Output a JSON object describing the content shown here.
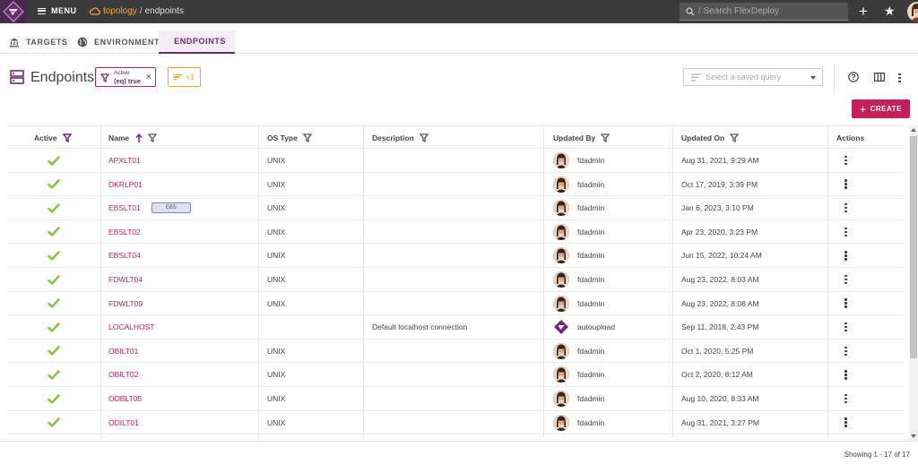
{
  "topbar": {
    "menu_label": "MENU",
    "breadcrumb": {
      "root": "topology",
      "separator": "/",
      "current": "endpoints"
    },
    "search_placeholder": "/ Search FlexDeploy"
  },
  "tabs": [
    {
      "label": "TARGETS",
      "icon": "bank-icon",
      "active": false
    },
    {
      "label": "ENVIRONMENTS",
      "icon": "globe-icon",
      "active": false
    },
    {
      "label": "ENDPOINTS",
      "icon": "server-icon",
      "active": true
    }
  ],
  "page": {
    "title": "Endpoints",
    "filter_chip": {
      "label": "Active",
      "value": "(eq) true"
    },
    "sort_chip": {
      "label": "+1"
    },
    "saved_query_placeholder": "Select a saved query",
    "create_label": "CREATE"
  },
  "columns": [
    "Active",
    "Name",
    "OS Type",
    "Description",
    "Updated By",
    "Updated On",
    "Actions"
  ],
  "rows": [
    {
      "name": "APXLT01",
      "os": "UNIX",
      "description": "",
      "updated_by": "fdadmin",
      "updated_on": "Aug 31, 2021, 9:29 AM"
    },
    {
      "name": "DKRLP01",
      "os": "UNIX",
      "description": "",
      "updated_by": "fdadmin",
      "updated_on": "Oct 17, 2019, 3:39 PM"
    },
    {
      "name": "EBSLT01",
      "tag": "EBS",
      "os": "UNIX",
      "description": "",
      "updated_by": "fdadmin",
      "updated_on": "Jan 6, 2023, 3:10 PM"
    },
    {
      "name": "EBSLT02",
      "os": "UNIX",
      "description": "",
      "updated_by": "fdadmin",
      "updated_on": "Apr 23, 2020, 3:23 PM"
    },
    {
      "name": "EBSLT04",
      "os": "UNIX",
      "description": "",
      "updated_by": "fdadmin",
      "updated_on": "Jun 15, 2022, 10:24 AM"
    },
    {
      "name": "FDWLT04",
      "os": "UNIX",
      "description": "",
      "updated_by": "fdadmin",
      "updated_on": "Aug 23, 2022, 8:03 AM"
    },
    {
      "name": "FDWLT09",
      "os": "UNIX",
      "description": "",
      "updated_by": "fdadmin",
      "updated_on": "Aug 23, 2022, 8:08 AM"
    },
    {
      "name": "LOCALHOST",
      "os": "",
      "description": "Default localhost connection",
      "updated_by": "autoupload",
      "updated_on": "Sep 11, 2018, 2:43 PM"
    },
    {
      "name": "OBILT01",
      "os": "UNIX",
      "description": "",
      "updated_by": "fdadmin",
      "updated_on": "Oct 1, 2020, 5:25 PM"
    },
    {
      "name": "OBILT02",
      "os": "UNIX",
      "description": "",
      "updated_by": "fdadmin",
      "updated_on": "Oct 2, 2020, 8:12 AM"
    },
    {
      "name": "ODBLT05",
      "os": "UNIX",
      "description": "",
      "updated_by": "fdadmin",
      "updated_on": "Aug 10, 2020, 8:33 AM"
    },
    {
      "name": "ODILT01",
      "os": "UNIX",
      "description": "",
      "updated_by": "fdadmin",
      "updated_on": "Aug 31, 2021, 3:27 PM"
    }
  ],
  "footer": {
    "showing": "Showing 1 - 17 of 17"
  },
  "colors": {
    "brand": "#6a2d72",
    "accent": "#c31f5a",
    "chip_orange": "#f5a623",
    "check": "#8bc34a"
  }
}
